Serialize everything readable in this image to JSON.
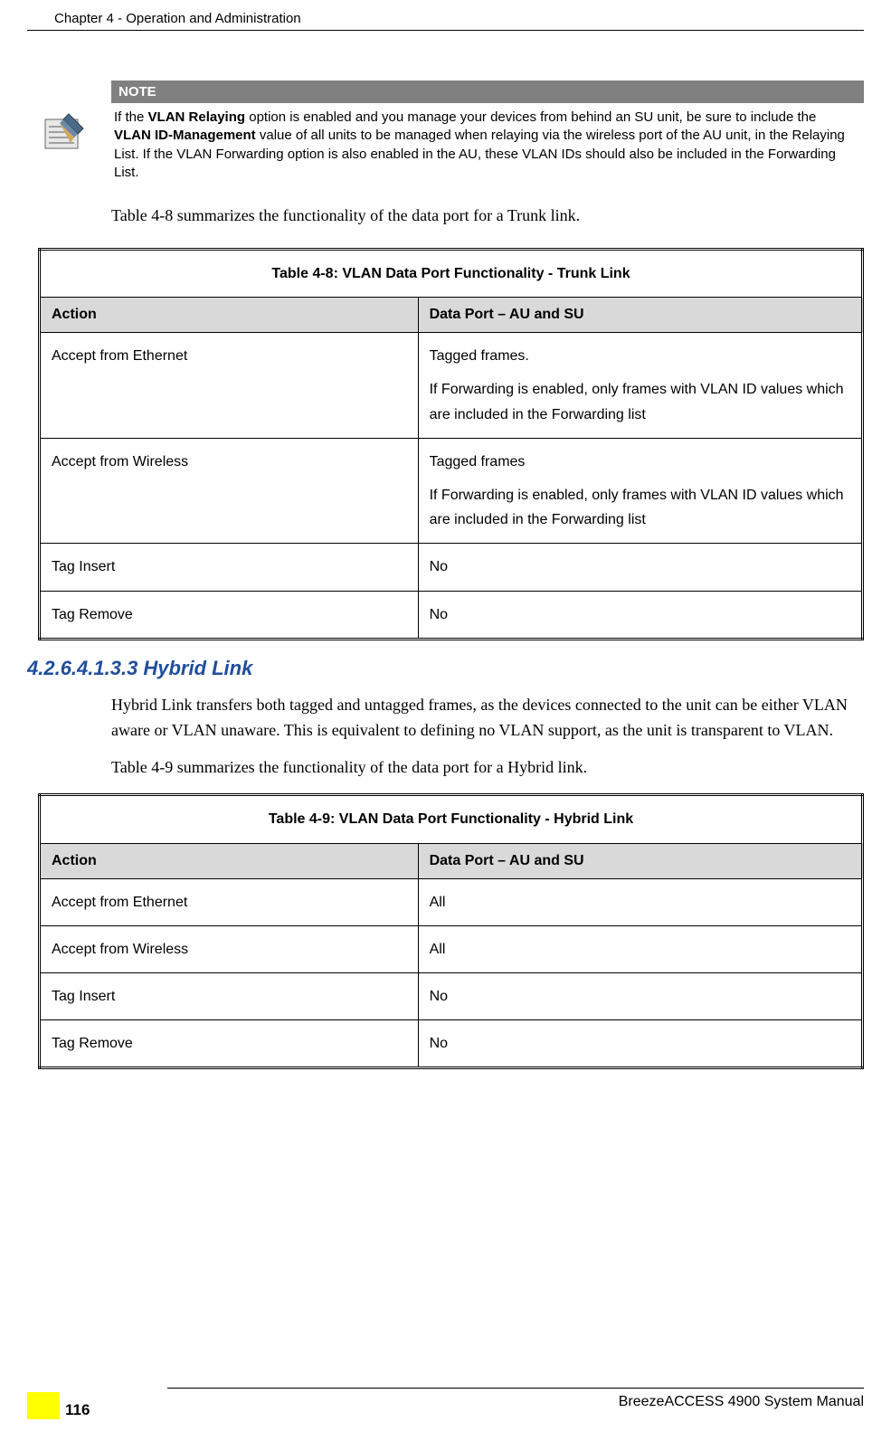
{
  "header": {
    "chapter_title": "Chapter 4 - Operation and Administration"
  },
  "note": {
    "label": "NOTE",
    "text_prefix": "If the ",
    "bold1": "VLAN Relaying",
    "text_mid1": " option is enabled and you manage your devices from behind an SU unit, be sure to include the ",
    "bold2": "VLAN ID-Management",
    "text_suffix": " value of all units to be managed when relaying via the wireless port of the AU unit, in the Relaying List. If the VLAN Forwarding option is also enabled in the AU, these VLAN IDs should also be included in the Forwarding List."
  },
  "intro1": "Table 4-8 summarizes the functionality of the data port for a Trunk link.",
  "table1": {
    "title": "Table 4-8: VLAN Data Port Functionality - Trunk Link",
    "col1": "Action",
    "col2": "Data Port – AU and SU",
    "rows": [
      {
        "action": "Accept from Ethernet",
        "port_p1": "Tagged frames.",
        "port_p2": "If Forwarding is enabled, only frames with VLAN ID values which are included in the Forwarding list"
      },
      {
        "action": "Accept from Wireless",
        "port_p1": "Tagged frames",
        "port_p2": "If Forwarding is enabled, only frames with VLAN ID values which are included in the Forwarding list"
      },
      {
        "action": "Tag Insert",
        "port_p1": "No",
        "port_p2": ""
      },
      {
        "action": "Tag Remove",
        "port_p1": "No",
        "port_p2": ""
      }
    ]
  },
  "section": {
    "number": "4.2.6.4.1.3.3",
    "title": "Hybrid Link"
  },
  "body1": "Hybrid Link transfers both tagged and untagged frames, as the devices connected to the unit can be either VLAN aware or VLAN unaware. This is equivalent to defining no VLAN support, as the unit is transparent to VLAN.",
  "body2": "Table 4-9 summarizes the functionality of the data port for a Hybrid link.",
  "table2": {
    "title": "Table 4-9: VLAN Data Port Functionality - Hybrid Link",
    "col1": "Action",
    "col2": "Data Port – AU and SU",
    "rows": [
      {
        "action": "Accept from Ethernet",
        "port": "All"
      },
      {
        "action": "Accept from Wireless",
        "port": "All"
      },
      {
        "action": "Tag Insert",
        "port": "No"
      },
      {
        "action": "Tag Remove",
        "port": "No"
      }
    ]
  },
  "footer": {
    "manual_title": "BreezeACCESS 4900 System Manual",
    "page_number": "116"
  }
}
